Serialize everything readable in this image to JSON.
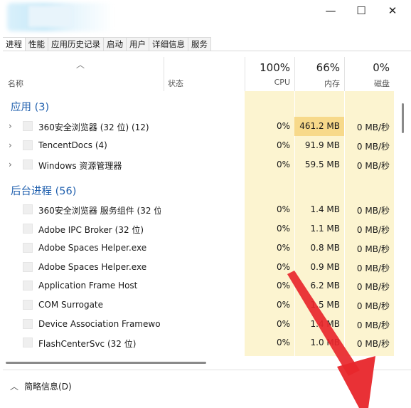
{
  "window": {
    "controls": {
      "minimize": "—",
      "maximize": "☐",
      "close": "✕"
    }
  },
  "tabs": [
    "进程",
    "性能",
    "应用历史记录",
    "启动",
    "用户",
    "详细信息",
    "服务"
  ],
  "header": {
    "sort_icon": "chevron-up",
    "name": "名称",
    "status": "状态",
    "cpu_pct": "100%",
    "cpu_label": "CPU",
    "mem_pct": "66%",
    "mem_label": "内存",
    "disk_pct": "0%",
    "disk_label": "磁盘"
  },
  "groups": {
    "apps": "应用 (3)",
    "background": "后台进程 (56)"
  },
  "app_rows": [
    {
      "name": "360安全浏览器 (32 位) (12)",
      "cpu": "0%",
      "mem": "461.2 MB",
      "disk": "0 MB/秒"
    },
    {
      "name": "TencentDocs (4)",
      "cpu": "0%",
      "mem": "91.9 MB",
      "disk": "0 MB/秒"
    },
    {
      "name": "Windows 资源管理器",
      "cpu": "0%",
      "mem": "59.5 MB",
      "disk": "0 MB/秒"
    }
  ],
  "bg_rows": [
    {
      "name": "360安全浏览器 服务组件 (32 位)",
      "cpu": "0%",
      "mem": "1.4 MB",
      "disk": "0 MB/秒"
    },
    {
      "name": "Adobe IPC Broker (32 位)",
      "cpu": "0%",
      "mem": "1.1 MB",
      "disk": "0 MB/秒"
    },
    {
      "name": "Adobe Spaces Helper.exe",
      "cpu": "0%",
      "mem": "0.8 MB",
      "disk": "0 MB/秒"
    },
    {
      "name": "Adobe Spaces Helper.exe",
      "cpu": "0%",
      "mem": "0.9 MB",
      "disk": "0 MB/秒"
    },
    {
      "name": "Application Frame Host",
      "cpu": "0%",
      "mem": "6.2 MB",
      "disk": "0 MB/秒"
    },
    {
      "name": "COM Surrogate",
      "cpu": "0%",
      "mem": "1.5 MB",
      "disk": "0 MB/秒"
    },
    {
      "name": "Device Association Framewo...",
      "cpu": "0%",
      "mem": "1.4 MB",
      "disk": "0 MB/秒"
    },
    {
      "name": "FlashCenterSvc (32 位)",
      "cpu": "0%",
      "mem": "1.0 MB",
      "disk": "0 MB/秒"
    }
  ],
  "footer": {
    "label": "简略信息(D)"
  },
  "colors": {
    "group_blue": "#1f5fae",
    "column_bg": "#fcf4d0",
    "mem_highlight": "#f7d98a",
    "arrow_red": "#e8262b"
  }
}
